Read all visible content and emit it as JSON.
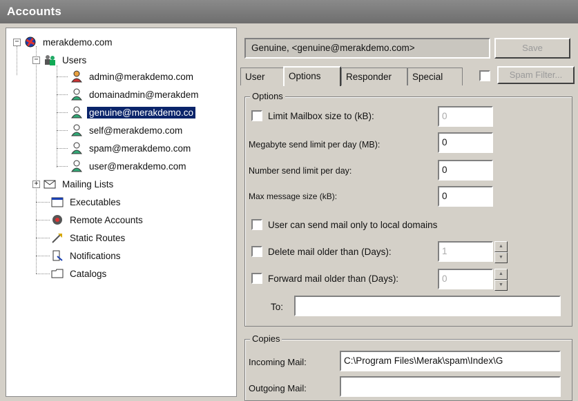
{
  "window": {
    "title": "Accounts"
  },
  "tree": {
    "root": "merakdemo.com",
    "users_label": "Users",
    "users": [
      "admin@merakdemo.com",
      "domainadmin@merakdem",
      "genuine@merakdemo.co",
      "self@merakdemo.com",
      "spam@merakdemo.com",
      "user@merakdemo.com"
    ],
    "selected_index": 2,
    "others": [
      "Mailing Lists",
      "Executables",
      "Remote Accounts",
      "Static Routes",
      "Notifications",
      "Catalogs"
    ]
  },
  "account": {
    "display": "Genuine, <genuine@merakdemo.com>",
    "save_label": "Save",
    "spam_filter_label": "Spam Filter..."
  },
  "tabs": [
    "User",
    "Options",
    "Responder",
    "Special"
  ],
  "active_tab": "Options",
  "options": {
    "group_label": "Options",
    "limit_mailbox_label": "Limit Mailbox size to (kB):",
    "limit_mailbox_value": "0",
    "mb_send_limit_label": "Megabyte send limit per day (MB):",
    "mb_send_limit_value": "0",
    "number_send_limit_label": "Number send limit per day:",
    "number_send_limit_value": "0",
    "max_message_label": "Max message size (kB):",
    "max_message_value": "0",
    "local_only_label": "User can send mail only to local domains",
    "delete_older_label": "Delete mail older than (Days):",
    "delete_older_value": "1",
    "forward_older_label": "Forward mail older than (Days):",
    "forward_older_value": "0",
    "to_label": "To:",
    "to_value": ""
  },
  "copies": {
    "group_label": "Copies",
    "incoming_label": "Incoming Mail:",
    "incoming_value": "C:\\Program Files\\Merak\\spam\\Index\\G",
    "outgoing_label": "Outgoing Mail:",
    "outgoing_value": ""
  }
}
